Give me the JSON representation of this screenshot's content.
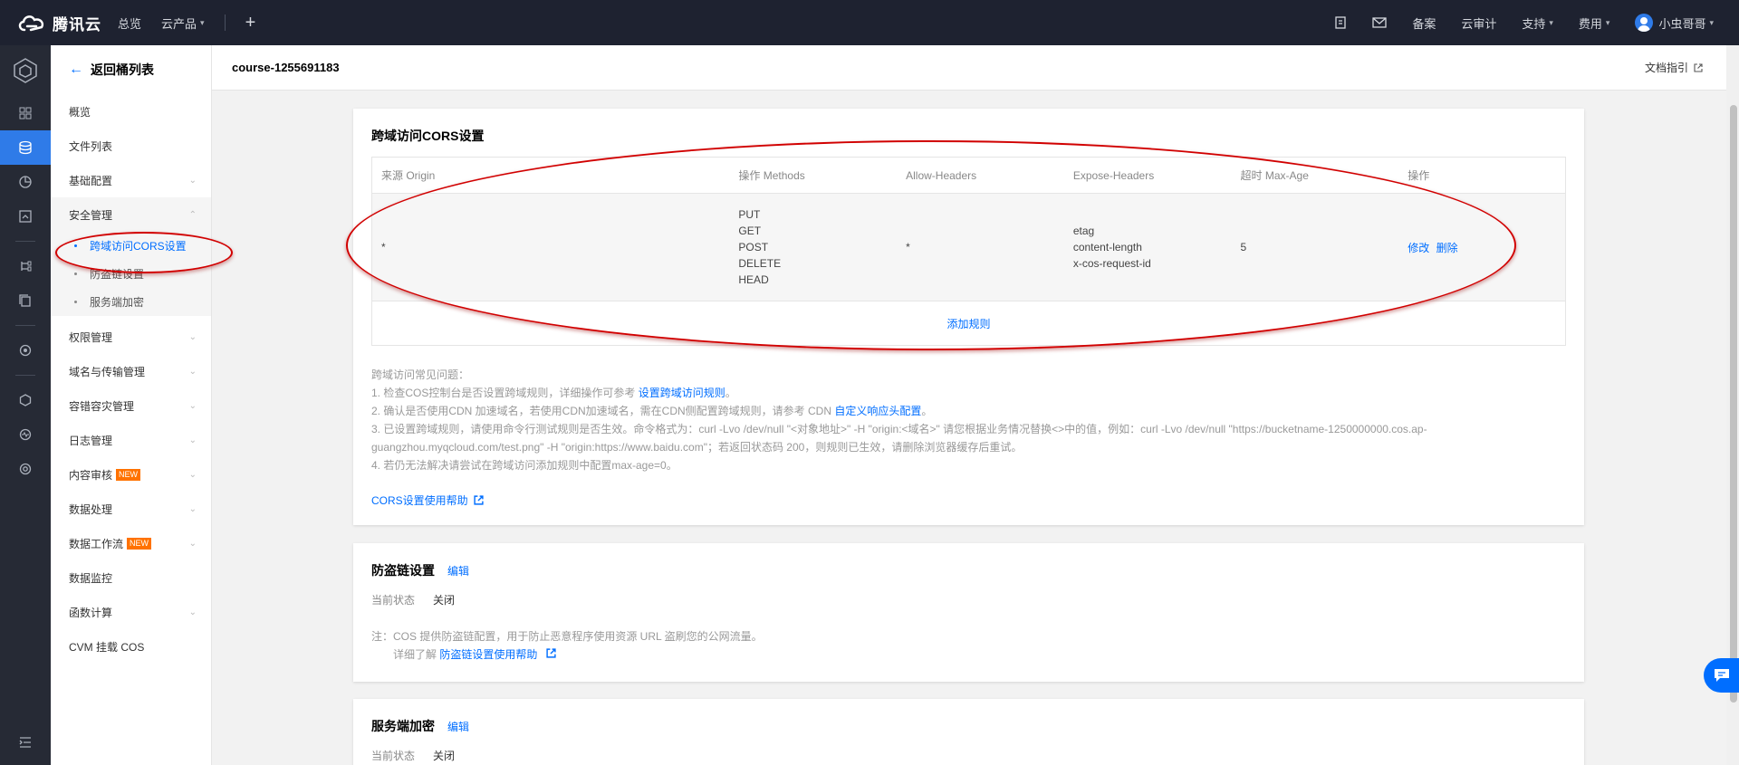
{
  "topnav": {
    "brand": "腾讯云",
    "overview": "总览",
    "products": "云产品",
    "plus": "+",
    "filing": "备案",
    "audit": "云审计",
    "support": "支持",
    "billing": "费用",
    "username": "小虫哥哥"
  },
  "sidebar": {
    "back_label": "返回桶列表",
    "items": [
      {
        "label": "概览"
      },
      {
        "label": "文件列表"
      },
      {
        "label": "基础配置"
      },
      {
        "label": "安全管理"
      }
    ],
    "security_sub": [
      {
        "label": "跨域访问CORS设置"
      },
      {
        "label": "防盗链设置"
      },
      {
        "label": "服务端加密"
      }
    ],
    "lower_items": [
      {
        "label": "权限管理"
      },
      {
        "label": "域名与传输管理"
      },
      {
        "label": "容错容灾管理"
      },
      {
        "label": "日志管理"
      },
      {
        "label": "内容审核",
        "badge": "NEW"
      },
      {
        "label": "数据处理"
      },
      {
        "label": "数据工作流",
        "badge": "NEW"
      },
      {
        "label": "数据监控"
      },
      {
        "label": "函数计算"
      },
      {
        "label": "CVM 挂载 COS"
      }
    ]
  },
  "header": {
    "bucket": "course-1255691183",
    "doc_link": "文档指引"
  },
  "cors": {
    "title": "跨域访问CORS设置",
    "columns": [
      "来源 Origin",
      "操作 Methods",
      "Allow-Headers",
      "Expose-Headers",
      "超时 Max-Age",
      "操作"
    ],
    "row": {
      "origin": "*",
      "methods": [
        "PUT",
        "GET",
        "POST",
        "DELETE",
        "HEAD"
      ],
      "allow_headers": "*",
      "expose_headers": [
        "etag",
        "content-length",
        "x-cos-request-id"
      ],
      "max_age": "5",
      "edit": "修改",
      "delete": "删除"
    },
    "add_rule": "添加规则",
    "faq": {
      "title": "跨域访问常见问题：",
      "l1_pre": "1. 检查COS控制台是否设置跨域规则，详细操作可参考 ",
      "l1_link": "设置跨域访问规则",
      "l1_post": "。",
      "l2_pre": "2. 确认是否使用CDN 加速域名，若使用CDN加速域名，需在CDN侧配置跨域规则，请参考 CDN ",
      "l2_link": "自定义响应头配置",
      "l2_post": "。",
      "l3": "3. 已设置跨域规则，请使用命令行测试规则是否生效。命令格式为：curl -Lvo /dev/null \"<对象地址>\" -H \"origin:<域名>\" 请您根据业务情况替换<>中的值，例如：curl -Lvo /dev/null \"https://bucketname-1250000000.cos.ap-guangzhou.myqcloud.com/test.png\" -H \"origin:https://www.baidu.com\"；若返回状态码 200，则规则已生效，请删除浏览器缓存后重试。",
      "l4": "4. 若仍无法解决请尝试在跨域访问添加规则中配置max-age=0。"
    },
    "help": "CORS设置使用帮助"
  },
  "hotlink": {
    "title": "防盗链设置",
    "edit": "编辑",
    "state_label": "当前状态",
    "state_value": "关闭",
    "note": "注：COS 提供防盗链配置，用于防止恶意程序使用资源 URL 盗刷您的公网流量。",
    "detail_pre": "详细了解 ",
    "detail_link": "防盗链设置使用帮助"
  },
  "encryption": {
    "title": "服务端加密",
    "edit": "编辑",
    "state_label": "当前状态",
    "state_value": "关闭"
  },
  "colors": {
    "accent": "#006eff",
    "topbar": "#1e2230",
    "annotation": "#d10000",
    "new_badge": "#ff7200"
  }
}
